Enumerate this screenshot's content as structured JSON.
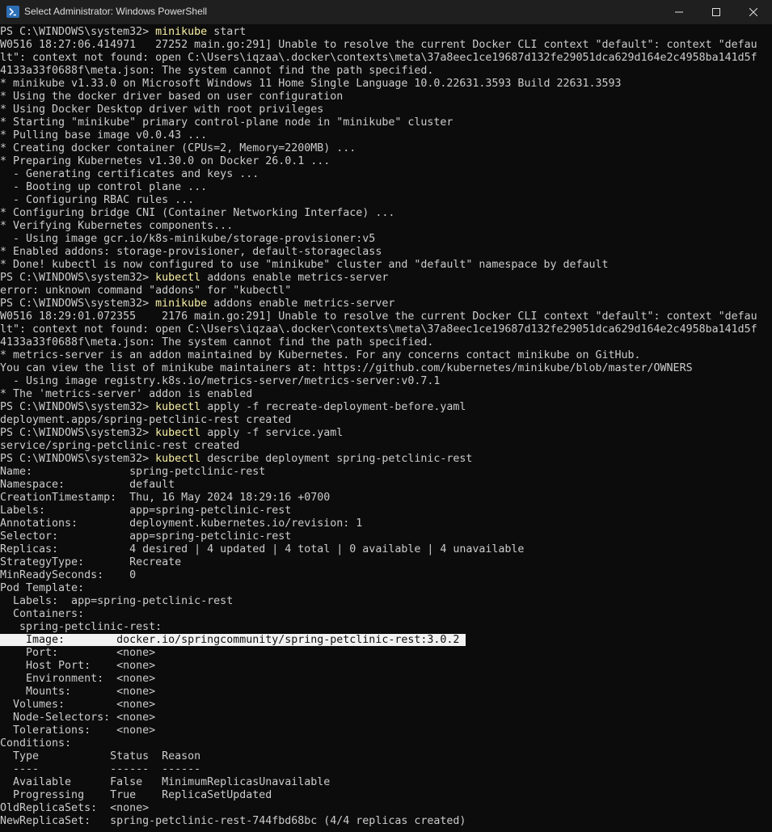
{
  "window": {
    "title": "Select Administrator: Windows PowerShell",
    "icon": "powershell-icon",
    "controls": [
      "minimize-icon",
      "maximize-icon",
      "close-icon"
    ]
  },
  "colors": {
    "background": "#0c0c0c",
    "text": "#cccccc",
    "command": "#f9f1a5",
    "selection": "#f2f2f2"
  },
  "terminal": {
    "prompt": "PS C:\\WINDOWS\\system32> ",
    "lines": [
      {
        "type": "prompt",
        "cmd": "minikube",
        "args": " start"
      },
      {
        "type": "output",
        "text": "W0516 18:27:06.414971   27252 main.go:291] Unable to resolve the current Docker CLI context \"default\": context \"defau"
      },
      {
        "type": "output",
        "text": "lt\": context not found: open C:\\Users\\iqzaa\\.docker\\contexts\\meta\\37a8eec1ce19687d132fe29051dca629d164e2c4958ba141d5f"
      },
      {
        "type": "output",
        "text": "4133a33f0688f\\meta.json: The system cannot find the path specified."
      },
      {
        "type": "output",
        "text": "* minikube v1.33.0 on Microsoft Windows 11 Home Single Language 10.0.22631.3593 Build 22631.3593"
      },
      {
        "type": "output",
        "text": "* Using the docker driver based on user configuration"
      },
      {
        "type": "output",
        "text": "* Using Docker Desktop driver with root privileges"
      },
      {
        "type": "output",
        "text": "* Starting \"minikube\" primary control-plane node in \"minikube\" cluster"
      },
      {
        "type": "output",
        "text": "* Pulling base image v0.0.43 ..."
      },
      {
        "type": "output",
        "text": "* Creating docker container (CPUs=2, Memory=2200MB) ..."
      },
      {
        "type": "output",
        "text": "* Preparing Kubernetes v1.30.0 on Docker 26.0.1 ..."
      },
      {
        "type": "output",
        "text": "  - Generating certificates and keys ..."
      },
      {
        "type": "output",
        "text": "  - Booting up control plane ..."
      },
      {
        "type": "output",
        "text": "  - Configuring RBAC rules ..."
      },
      {
        "type": "output",
        "text": "* Configuring bridge CNI (Container Networking Interface) ..."
      },
      {
        "type": "output",
        "text": "* Verifying Kubernetes components..."
      },
      {
        "type": "output",
        "text": "  - Using image gcr.io/k8s-minikube/storage-provisioner:v5"
      },
      {
        "type": "output",
        "text": "* Enabled addons: storage-provisioner, default-storageclass"
      },
      {
        "type": "output",
        "text": "* Done! kubectl is now configured to use \"minikube\" cluster and \"default\" namespace by default"
      },
      {
        "type": "prompt",
        "cmd": "kubectl",
        "args": " addons enable metrics-server"
      },
      {
        "type": "output",
        "text": "error: unknown command \"addons\" for \"kubectl\""
      },
      {
        "type": "prompt",
        "cmd": "minikube",
        "args": " addons enable metrics-server"
      },
      {
        "type": "output",
        "text": "W0516 18:29:01.072355    2176 main.go:291] Unable to resolve the current Docker CLI context \"default\": context \"defau"
      },
      {
        "type": "output",
        "text": "lt\": context not found: open C:\\Users\\iqzaa\\.docker\\contexts\\meta\\37a8eec1ce19687d132fe29051dca629d164e2c4958ba141d5f"
      },
      {
        "type": "output",
        "text": "4133a33f0688f\\meta.json: The system cannot find the path specified."
      },
      {
        "type": "output",
        "text": "* metrics-server is an addon maintained by Kubernetes. For any concerns contact minikube on GitHub."
      },
      {
        "type": "output",
        "text": "You can view the list of minikube maintainers at: https://github.com/kubernetes/minikube/blob/master/OWNERS"
      },
      {
        "type": "output",
        "text": "  - Using image registry.k8s.io/metrics-server/metrics-server:v0.7.1"
      },
      {
        "type": "output",
        "text": "* The 'metrics-server' addon is enabled"
      },
      {
        "type": "prompt",
        "cmd": "kubectl",
        "args": " apply -f recreate-deployment-before.yaml"
      },
      {
        "type": "output",
        "text": "deployment.apps/spring-petclinic-rest created"
      },
      {
        "type": "prompt",
        "cmd": "kubectl",
        "args": " apply -f service.yaml"
      },
      {
        "type": "output",
        "text": "service/spring-petclinic-rest created"
      },
      {
        "type": "prompt",
        "cmd": "kubectl",
        "args": " describe deployment spring-petclinic-rest"
      },
      {
        "type": "output",
        "text": "Name:               spring-petclinic-rest"
      },
      {
        "type": "output",
        "text": "Namespace:          default"
      },
      {
        "type": "output",
        "text": "CreationTimestamp:  Thu, 16 May 2024 18:29:16 +0700"
      },
      {
        "type": "output",
        "text": "Labels:             app=spring-petclinic-rest"
      },
      {
        "type": "output",
        "text": "Annotations:        deployment.kubernetes.io/revision: 1"
      },
      {
        "type": "output",
        "text": "Selector:           app=spring-petclinic-rest"
      },
      {
        "type": "output",
        "text": "Replicas:           4 desired | 4 updated | 4 total | 0 available | 4 unavailable"
      },
      {
        "type": "output",
        "text": "StrategyType:       Recreate"
      },
      {
        "type": "output",
        "text": "MinReadySeconds:    0"
      },
      {
        "type": "output",
        "text": "Pod Template:"
      },
      {
        "type": "output",
        "text": "  Labels:  app=spring-petclinic-rest"
      },
      {
        "type": "output",
        "text": "  Containers:"
      },
      {
        "type": "output",
        "text": "   spring-petclinic-rest:"
      },
      {
        "type": "selected",
        "text": "    Image:        docker.io/springcommunity/spring-petclinic-rest:3.0.2 "
      },
      {
        "type": "output",
        "text": "    Port:         <none>"
      },
      {
        "type": "output",
        "text": "    Host Port:    <none>"
      },
      {
        "type": "output",
        "text": "    Environment:  <none>"
      },
      {
        "type": "output",
        "text": "    Mounts:       <none>"
      },
      {
        "type": "output",
        "text": "  Volumes:        <none>"
      },
      {
        "type": "output",
        "text": "  Node-Selectors: <none>"
      },
      {
        "type": "output",
        "text": "  Tolerations:    <none>"
      },
      {
        "type": "output",
        "text": "Conditions:"
      },
      {
        "type": "output",
        "text": "  Type           Status  Reason"
      },
      {
        "type": "output",
        "text": "  ----           ------  ------"
      },
      {
        "type": "output",
        "text": "  Available      False   MinimumReplicasUnavailable"
      },
      {
        "type": "output",
        "text": "  Progressing    True    ReplicaSetUpdated"
      },
      {
        "type": "output",
        "text": "OldReplicaSets:  <none>"
      },
      {
        "type": "output",
        "text": "NewReplicaSet:   spring-petclinic-rest-744fbd68bc (4/4 replicas created)"
      }
    ]
  }
}
